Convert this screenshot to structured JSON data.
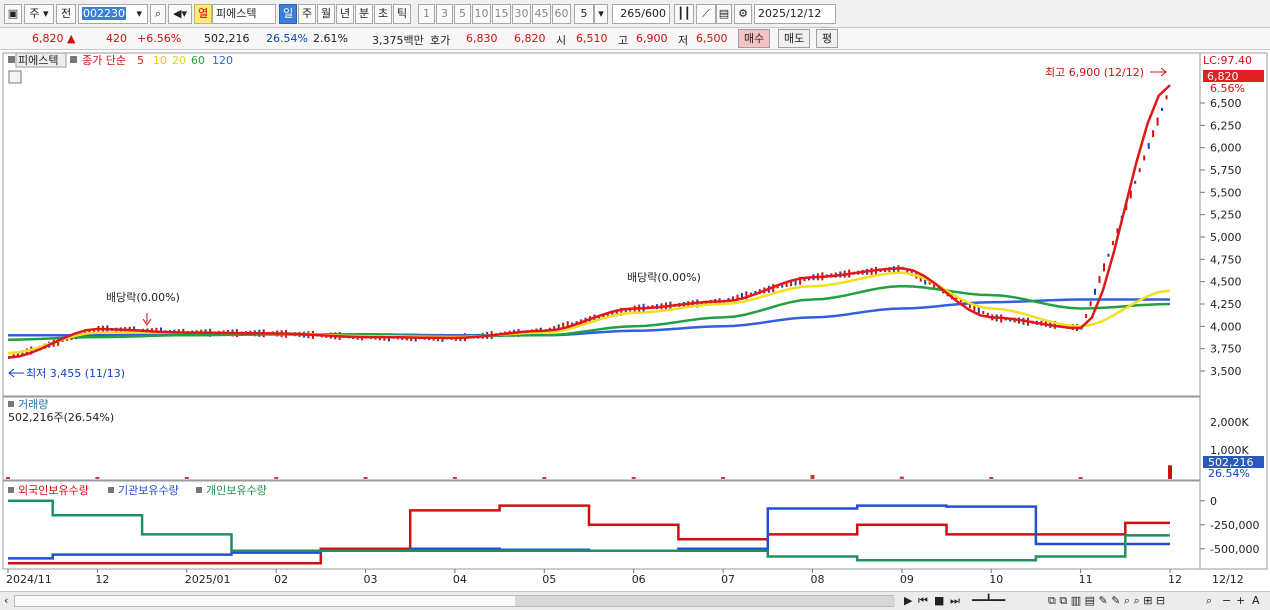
{
  "toolbar": {
    "type_select": "주",
    "prefix_select": "전",
    "code_input": "002230",
    "market_button": "열",
    "stock_name": "피에스텍",
    "periods": [
      "일",
      "주",
      "월",
      "년",
      "분",
      "초",
      "틱"
    ],
    "active_period": "일",
    "intervals": [
      "1",
      "3",
      "5",
      "10",
      "15",
      "30",
      "45",
      "60"
    ],
    "count_select": "5",
    "count_field": "265",
    "count_total": "/600",
    "date_field": "2025/12/12"
  },
  "quote": {
    "price": "6,820",
    "change": "420",
    "change_pct": "+6.56%",
    "volume": "502,216",
    "volume_ratio": "26.54%",
    "turnover": "2.61%",
    "amount": "3,375백만",
    "bid_label": "호가",
    "ask": "6,830",
    "bid": "6,820",
    "open_label": "시",
    "open": "6,510",
    "high_label": "고",
    "high": "6,900",
    "low_label": "저",
    "low": "6,500",
    "buy_button": "매수",
    "sell_button": "매도",
    "eval_button": "평"
  },
  "price_panel": {
    "legend_name": "피에스텍",
    "legend_ma": "종가 단순",
    "ma_periods": [
      "5",
      "10",
      "20",
      "60",
      "120"
    ],
    "annotation_dividend": "배당락(0.00%)",
    "annotation_high": "최고 6,900 (12/12)",
    "annotation_low": "최저 3,455 (11/13)",
    "lc_label": "LC:97.40",
    "last_price": "6,820",
    "last_pct": "6.56%",
    "y_ticks": [
      "6,500",
      "6,250",
      "6,000",
      "5,750",
      "5,500",
      "5,250",
      "5,000",
      "4,750",
      "4,500",
      "4,250",
      "4,000",
      "3,750",
      "3,500"
    ]
  },
  "volume_panel": {
    "title": "거래량",
    "value_text": "502,216주(26.54%)",
    "y_ticks": [
      "2,000K",
      "1,000K"
    ],
    "last_value": "502,216",
    "last_pct": "26.54%"
  },
  "holdings_panel": {
    "legend": [
      "외국인보유수량",
      "기관보유수량",
      "개인보유수량"
    ],
    "y_ticks": [
      "0",
      "-250,000",
      "-500,000"
    ]
  },
  "x_axis": [
    "2024/11",
    "12",
    "2025/01",
    "02",
    "03",
    "04",
    "05",
    "06",
    "07",
    "08",
    "09",
    "10",
    "11",
    "12"
  ],
  "x_axis_right": "12/12",
  "colors": {
    "up": "#d01010",
    "down": "#1040c0",
    "ma5": "#e01818",
    "ma10": "#f08010",
    "ma20": "#f0e020",
    "ma60": "#20a040",
    "ma120": "#3060e0"
  },
  "chart_data": {
    "type": "line",
    "title": "피에스텍",
    "x": [
      "2024/11",
      "12",
      "2025/01",
      "02",
      "03",
      "04",
      "05",
      "06",
      "07",
      "08",
      "09",
      "10",
      "11",
      "12"
    ],
    "ylim": [
      3400,
      6900
    ],
    "series": [
      {
        "name": "5",
        "values": [
          3650,
          3970,
          3930,
          3920,
          3880,
          3870,
          3950,
          4200,
          4280,
          4550,
          4650,
          4100,
          3980,
          6700
        ]
      },
      {
        "name": "20",
        "values": [
          3700,
          3930,
          3930,
          3920,
          3890,
          3880,
          3930,
          4150,
          4250,
          4450,
          4600,
          4200,
          4000,
          4400
        ]
      },
      {
        "name": "60",
        "values": [
          3850,
          3880,
          3900,
          3910,
          3900,
          3890,
          3900,
          4000,
          4100,
          4300,
          4450,
          4350,
          4200,
          4250
        ]
      },
      {
        "name": "120",
        "values": [
          3900,
          3900,
          3910,
          3910,
          3910,
          3900,
          3900,
          3950,
          4000,
          4100,
          4200,
          4270,
          4300,
          4300
        ]
      }
    ],
    "volume": {
      "ylim": [
        0,
        2500000
      ],
      "values": [
        60000,
        40000,
        30000,
        30000,
        35000,
        30000,
        40000,
        50000,
        60000,
        150000,
        90000,
        70000,
        60000,
        502216
      ]
    },
    "holdings": {
      "ylim": [
        -700000,
        50000
      ],
      "series": [
        {
          "name": "외국인보유수량",
          "values": [
            -650000,
            -650000,
            -650000,
            -650000,
            -500000,
            -100000,
            -50000,
            -250000,
            -400000,
            -350000,
            -250000,
            -350000,
            -350000,
            -230000
          ]
        },
        {
          "name": "기관보유수량",
          "values": [
            -600000,
            -560000,
            -560000,
            -540000,
            -520000,
            -500000,
            -510000,
            -520000,
            -500000,
            -80000,
            -50000,
            -60000,
            -450000,
            -450000
          ]
        },
        {
          "name": "개인보유수량",
          "values": [
            0,
            -150000,
            -350000,
            -520000,
            -520000,
            -520000,
            -520000,
            -520000,
            -520000,
            -580000,
            -620000,
            -620000,
            -580000,
            -360000
          ]
        }
      ]
    }
  }
}
